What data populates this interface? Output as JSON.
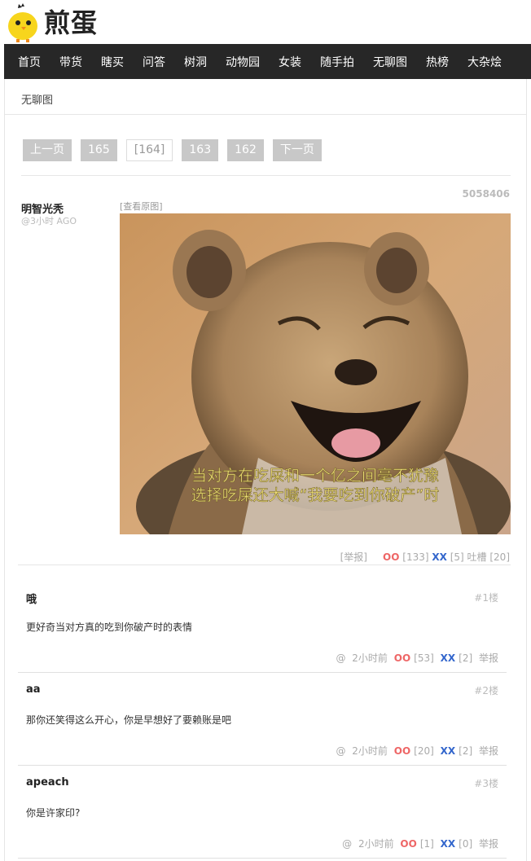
{
  "logo": {
    "text": "煎蛋"
  },
  "nav": [
    "首页",
    "带货",
    "瞎买",
    "问答",
    "树洞",
    "动物园",
    "女装",
    "随手拍",
    "无聊图",
    "热榜",
    "大杂烩"
  ],
  "breadcrumb": "无聊图",
  "pager": {
    "prev": "上一页",
    "p1": "165",
    "current": "[164]",
    "p3": "163",
    "p4": "162",
    "next": "下一页"
  },
  "post": {
    "id": "5058406",
    "author": "明智光秃",
    "time": "@3小时 AGO",
    "view_original": "[查看原图]",
    "caption_line1": "当对方在吃屎和一个亿之间毫不犹豫",
    "caption_line2": "选择吃屎还大喊“我要吃到你破产”时",
    "report": "[举报]",
    "oo_label": "OO",
    "oo_count": "[133]",
    "xx_label": "XX",
    "xx_count": "[5]",
    "tucao": "吐槽 [20]"
  },
  "comments": [
    {
      "author": "哦",
      "floor": "#1楼",
      "text": "更好奇当对方真的吃到你破产时的表情",
      "at": "@",
      "time": "2小时前",
      "oo_label": "OO",
      "oo": "[53]",
      "xx_label": "XX",
      "xx": "[2]",
      "report": "举报"
    },
    {
      "author": "aa",
      "floor": "#2楼",
      "text": "那你还笑得这么开心，你是早想好了要赖账是吧",
      "at": "@",
      "time": "2小时前",
      "oo_label": "OO",
      "oo": "[20]",
      "xx_label": "XX",
      "xx": "[2]",
      "report": "举报"
    },
    {
      "author": "apeach",
      "floor": "#3楼",
      "text": "你是许家印?",
      "at": "@",
      "time": "2小时前",
      "oo_label": "OO",
      "oo": "[1]",
      "xx_label": "XX",
      "xx": "[0]",
      "report": "举报"
    }
  ],
  "colors": {
    "nav_bg": "#272727",
    "oo": "#ee6666",
    "xx": "#3366cc",
    "pager_bg": "#c8c8c8"
  }
}
